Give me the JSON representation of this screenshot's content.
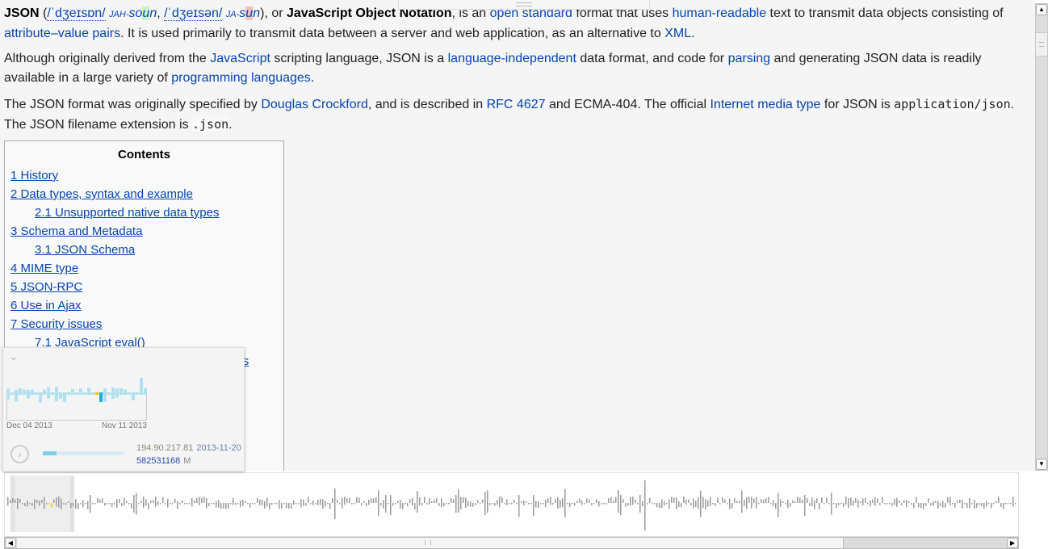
{
  "article": {
    "paragraphs": [
      [
        {
          "t": "JSON",
          "k": "b"
        },
        {
          "t": " ("
        },
        {
          "t": "/ˈdʒeɪsɒn/",
          "k": "ipa"
        },
        {
          "t": " "
        },
        {
          "t": "jah-",
          "k": "sc"
        },
        {
          "t": "so",
          "k": "i"
        },
        {
          "t": "u",
          "k": "ig"
        },
        {
          "t": "n",
          "k": "i"
        },
        {
          "t": ", "
        },
        {
          "t": "/ˈdʒeɪsən/",
          "k": "ipa"
        },
        {
          "t": " "
        },
        {
          "t": "ja-",
          "k": "sc"
        },
        {
          "t": "s",
          "k": "i"
        },
        {
          "t": "u",
          "k": "ir"
        },
        {
          "t": "n",
          "k": "i"
        },
        {
          "t": "), or "
        },
        {
          "t": "JavaScript Object Notation",
          "k": "b"
        },
        {
          "t": ", is an "
        },
        {
          "t": "open standard",
          "k": "a"
        },
        {
          "t": " format that uses "
        },
        {
          "t": "human-readable",
          "k": "a"
        },
        {
          "t": " text to transmit data objects consisting of "
        },
        {
          "t": "attribute–value pairs",
          "k": "a"
        },
        {
          "t": ". It is used primarily to transmit data between a server and web application, as an alternative to "
        },
        {
          "t": "XML",
          "k": "a"
        },
        {
          "t": "."
        }
      ],
      [
        {
          "t": "Although originally derived from the "
        },
        {
          "t": "JavaScript",
          "k": "a"
        },
        {
          "t": " scripting language, JSON is a "
        },
        {
          "t": "language-independent",
          "k": "a"
        },
        {
          "t": " data format, and code for "
        },
        {
          "t": "parsing",
          "k": "a"
        },
        {
          "t": " and generating JSON data is readily available in a large variety of "
        },
        {
          "t": "programming languages",
          "k": "a"
        },
        {
          "t": "."
        }
      ],
      [
        {
          "t": "The JSON format was originally specified by "
        },
        {
          "t": "Douglas Crockford",
          "k": "a"
        },
        {
          "t": ", and is described in "
        },
        {
          "t": "RFC 4627",
          "k": "a"
        },
        {
          "t": " and ECMA-404. The official "
        },
        {
          "t": "Internet media type",
          "k": "a"
        },
        {
          "t": " for JSON is "
        },
        {
          "t": "application/json",
          "k": "code"
        },
        {
          "t": ". The JSON filename extension is "
        },
        {
          "t": ".json",
          "k": "code"
        },
        {
          "t": "."
        }
      ]
    ]
  },
  "toc": {
    "title": "Contents",
    "items": [
      {
        "label": "1 History",
        "sub": false
      },
      {
        "label": "2 Data types, syntax and example",
        "sub": false
      },
      {
        "label": "2.1 Unsupported native data types",
        "sub": true
      },
      {
        "label": "3 Schema and Metadata",
        "sub": false
      },
      {
        "label": "3.1 JSON Schema",
        "sub": true
      },
      {
        "label": "4 MIME type",
        "sub": false
      },
      {
        "label": "5 JSON-RPC",
        "sub": false
      },
      {
        "label": "6 Use in Ajax",
        "sub": false
      },
      {
        "label": "7 Security issues",
        "sub": false
      },
      {
        "label": "7.1 JavaScript eval()",
        "sub": true
      },
      {
        "label": "8 Native encoding and decoding in browsers",
        "sub": false
      }
    ]
  },
  "popup": {
    "collapse_icon": "chevron-down-icon",
    "date_start": "Dec 04 2013",
    "date_end": "Nov 11 2013",
    "play_icon": "chevron-right-circle-icon",
    "progress_percent": 17,
    "ip": "194.90.217.81",
    "date": "2013-11-20",
    "revision": "582531168",
    "flag": "M"
  },
  "colors": {
    "link": "#0645ad",
    "bar": "#999999",
    "mini_bar": "#b3e0ee",
    "highlight": "#f5c400",
    "current": "#22aadd"
  }
}
